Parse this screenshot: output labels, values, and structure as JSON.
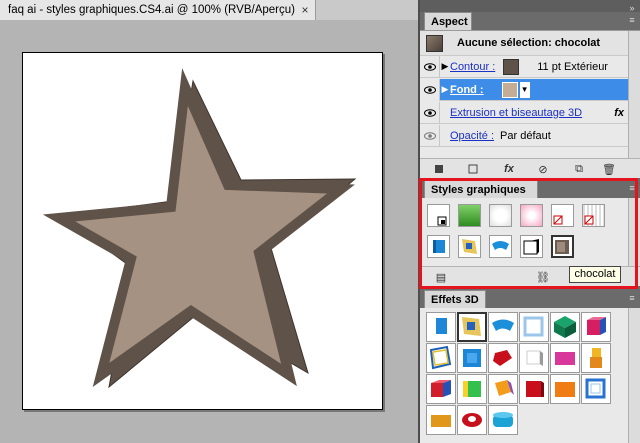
{
  "document": {
    "tab_title": "faq ai - styles graphiques.CS4.ai @ 100% (RVB/Aperçu)",
    "close_glyph": "×"
  },
  "star": {
    "face_color": "#a59282",
    "side_color": "#5f5249",
    "edge_color": "#3e342e"
  },
  "aspect_panel": {
    "tab_label": "Aspect",
    "header": "Aucune sélection: chocolat",
    "rows": [
      {
        "label": "Contour :",
        "value": "11 pt  Extérieur",
        "swatch": "#5f5249"
      },
      {
        "label": "Fond :",
        "swatch": "#c4ad95"
      },
      {
        "label": "Extrusion et biseautage 3D",
        "fx": "fx"
      },
      {
        "label": "Opacité :",
        "value": "Par défaut"
      }
    ],
    "footer_icons": [
      "square-icon",
      "stroke-icon",
      "fx-icon",
      "clear-icon",
      "duplicate-icon",
      "trash-icon"
    ]
  },
  "styles_panel": {
    "tab_label": "Styles graphiques",
    "tooltip": "chocolat",
    "swatches_row1": [
      "default",
      "green-gradient",
      "white-soft",
      "pink-soft",
      "white-none",
      "pattern-none"
    ],
    "swatches_row2": [
      "blue-cube",
      "yellow-cube",
      "blue-arc",
      "black-cube",
      "chocolat"
    ]
  },
  "effets_panel": {
    "tab_label": "Effets 3D"
  },
  "colors": {
    "accent_blue": "#3d8ce8",
    "highlight_red": "#e4141f"
  }
}
